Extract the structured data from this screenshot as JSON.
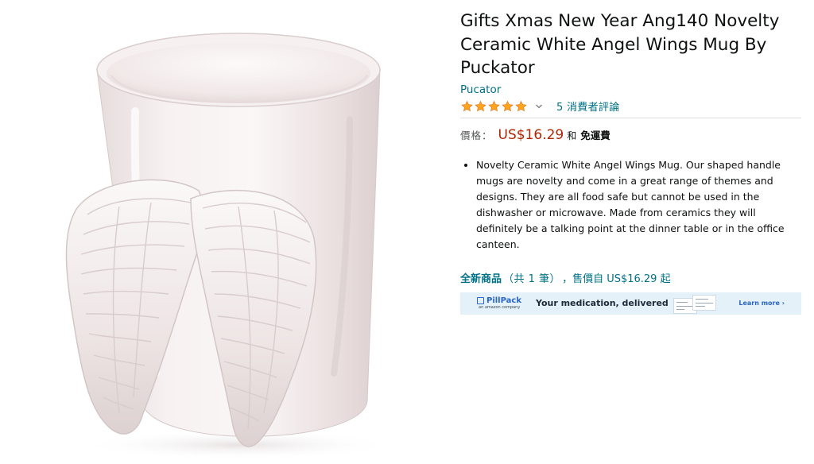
{
  "product": {
    "title": "Gifts Xmas New Year Ang140 Novelty Ceramic White Angel Wings Mug By Puckator",
    "brand": "Pucator",
    "rating": {
      "stars": 5,
      "reviews_link": "5 消費者評論"
    },
    "price": {
      "label": "價格：",
      "value": "US$16.29",
      "and": "和",
      "free_shipping": "免運費"
    },
    "bullets": [
      "Novelty Ceramic White Angel Wings Mug. Our shaped handle mugs are novelty and come in a great range of themes and designs. They are all food safe but cannot be used in the dishwasher or microwave. Made from ceramics they will definitely be a talking point at the dinner table or in the office canteen."
    ],
    "offers": {
      "new_label": "全新商品",
      "count_text": "（共 1 筆）",
      "from_text": "，售價自 US$16.29 起"
    }
  },
  "ad": {
    "logo_name": "PillPack",
    "logo_sub": "an amazon company",
    "tagline": "Your medication, delivered",
    "cta": "Learn more ›"
  },
  "icons": {
    "star": "star-icon",
    "chevron": "chevron-down-icon",
    "product_image": "angel-wings-mug"
  },
  "colors": {
    "link": "#007185",
    "price": "#b12704",
    "star": "#ffa41c",
    "ad_background": "#e4f1f8",
    "ad_brand": "#2a65c5"
  }
}
